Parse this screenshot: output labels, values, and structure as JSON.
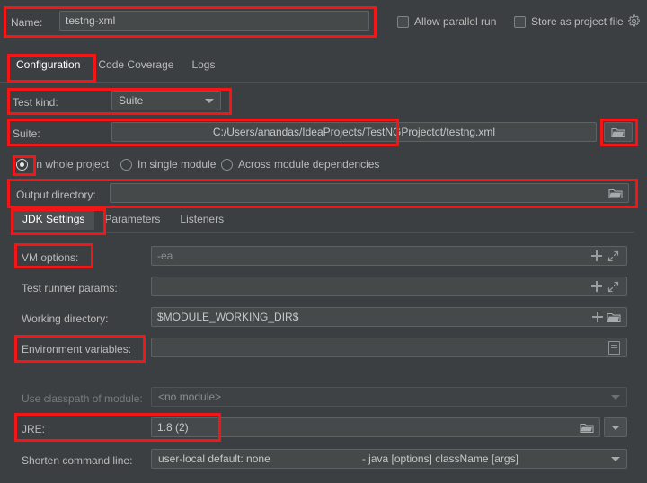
{
  "window": {
    "background_color": "#3c3f41",
    "annotation_color": "#f21616",
    "accent_color": "#4a88c7"
  },
  "header": {
    "name_label": "Name:",
    "name_value": "testng-xml",
    "allow_parallel_run_label": "Allow parallel run",
    "allow_parallel_run_checked": false,
    "store_as_project_file_label": "Store as project file",
    "store_as_project_file_checked": false,
    "gear_icon": "gear-icon"
  },
  "tabs": [
    {
      "label": "Configuration",
      "active": true
    },
    {
      "label": "Code Coverage",
      "active": false
    },
    {
      "label": "Logs",
      "active": false
    }
  ],
  "configuration": {
    "test_kind_label": "Test kind:",
    "test_kind_value": "Suite",
    "suite_label": "Suite:",
    "suite_value": "C:/Users/anandas/IdeaProjects/TestNGProjectct/testng.xml",
    "suite_browse_icon": "folder-icon",
    "scope_options": [
      {
        "label": "In whole project",
        "selected": true
      },
      {
        "label": "In single module",
        "selected": false
      },
      {
        "label": "Across module dependencies",
        "selected": false
      }
    ],
    "output_directory_label": "Output directory:",
    "output_directory_value": "",
    "output_directory_icon": "folder-icon"
  },
  "subtabs": [
    {
      "label": "JDK Settings",
      "active": true
    },
    {
      "label": "Parameters",
      "active": false
    },
    {
      "label": "Listeners",
      "active": false
    }
  ],
  "jdk_settings": {
    "vm_options_label": "VM options:",
    "vm_options_value": "-ea",
    "test_runner_params_label": "Test runner params:",
    "test_runner_params_value": "",
    "working_directory_label": "Working directory:",
    "working_directory_value": "$MODULE_WORKING_DIR$",
    "environment_variables_label": "Environment variables:",
    "environment_variables_value": "",
    "use_classpath_label": "Use classpath of module:",
    "use_classpath_value": "<no module>",
    "jre_label": "JRE:",
    "jre_value": "1.8 (2)",
    "shorten_command_line_label": "Shorten command line:",
    "shorten_command_line_value": "user-local default: none",
    "shorten_command_line_hint": "- java [options] className [args]"
  }
}
